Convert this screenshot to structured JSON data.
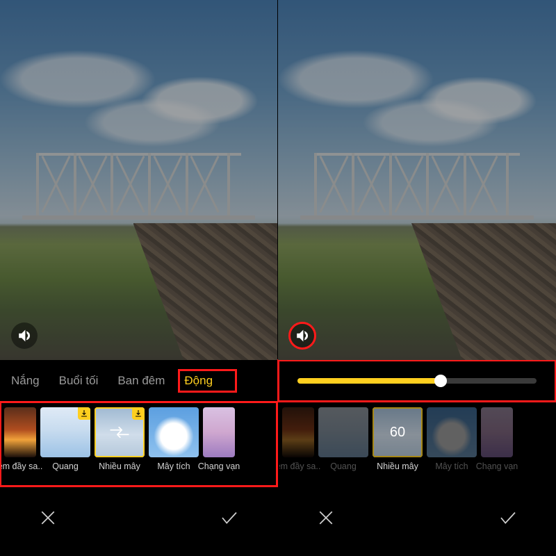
{
  "left": {
    "tabs": [
      {
        "id": "nang",
        "label": "Nắng",
        "active": false
      },
      {
        "id": "buoitoi",
        "label": "Buổi tối",
        "active": false
      },
      {
        "id": "bandem",
        "label": "Ban đêm",
        "active": false
      },
      {
        "id": "dong",
        "label": "Động",
        "active": true
      }
    ],
    "filters": [
      {
        "id": "emdaysa",
        "label": "êm đầy sa..",
        "thumb": "t-sunset",
        "download": false,
        "selected": false,
        "partial": true
      },
      {
        "id": "quang",
        "label": "Quang",
        "thumb": "t-glow",
        "download": true,
        "selected": false,
        "partial": false
      },
      {
        "id": "nhieumay",
        "label": "Nhiều mây",
        "thumb": "t-cloudy",
        "download": true,
        "selected": true,
        "partial": false,
        "motion": true
      },
      {
        "id": "maytich",
        "label": "Mây tích",
        "thumb": "t-cumu",
        "download": false,
        "selected": false,
        "partial": false
      },
      {
        "id": "changvan",
        "label": "Chạng vạn",
        "thumb": "t-dusk",
        "download": false,
        "selected": false,
        "partial": true
      }
    ],
    "highlight_mute": false,
    "highlight_strip": true,
    "highlight_tabrow_tail": true
  },
  "right": {
    "slider_value": 60,
    "slider_max": 100,
    "filters": [
      {
        "id": "emdaysa",
        "label": "êm đầy sa..",
        "thumb": "t-sunset",
        "selected": false,
        "partial": true
      },
      {
        "id": "quang",
        "label": "Quang",
        "thumb": "t-glow",
        "selected": false,
        "partial": false
      },
      {
        "id": "nhieumay",
        "label": "Nhiều mây",
        "thumb": "t-cloudy",
        "selected": true,
        "partial": false,
        "value": "60"
      },
      {
        "id": "maytich",
        "label": "Mây tích",
        "thumb": "t-cumu",
        "selected": false,
        "partial": false
      },
      {
        "id": "changvan",
        "label": "Chạng vạn",
        "thumb": "t-dusk",
        "selected": false,
        "partial": true
      }
    ],
    "highlight_mute": true,
    "highlight_slider": true
  },
  "icons": {
    "mute": "mute-icon",
    "cancel": "close-icon",
    "confirm": "check-icon",
    "download": "download-icon"
  }
}
